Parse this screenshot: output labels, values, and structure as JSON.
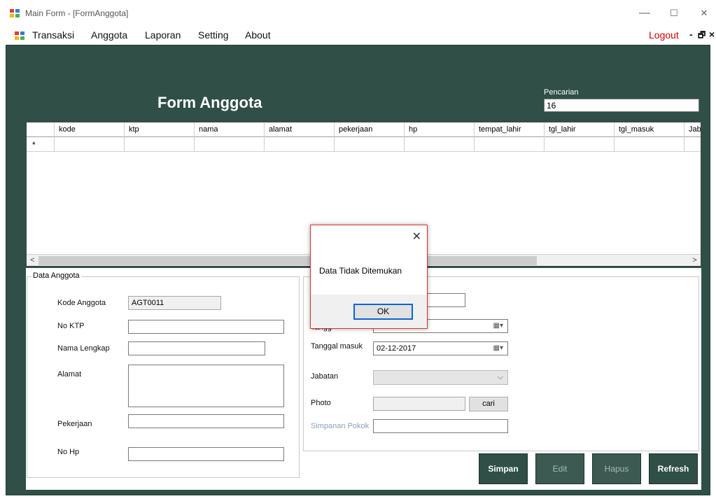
{
  "window": {
    "title": "Main Form - [FormAnggota]",
    "minimize": "—",
    "maximize": "☐",
    "close": "✕"
  },
  "menu": {
    "items": [
      "Transaksi",
      "Anggota",
      "Laporan",
      "Setting",
      "About"
    ],
    "logout": "Logout",
    "mdi_min": "-",
    "mdi_restore": "🗗",
    "mdi_close": "×"
  },
  "header": {
    "title": "Form Anggota",
    "search_label": "Pencarian",
    "search_value": "16"
  },
  "grid": {
    "columns": [
      "kode",
      "ktp",
      "nama",
      "alamat",
      "pekerjaan",
      "hp",
      "tempat_lahir",
      "tgl_lahir",
      "tgl_masuk",
      "Jab"
    ],
    "new_row_marker": "*",
    "scroll_left": "<",
    "scroll_right": ">"
  },
  "data_anggota": {
    "legend": "Data Anggota",
    "kode_label": "Kode Anggota",
    "kode_value": "AGT0011",
    "ktp_label": "No KTP",
    "nama_label": "Nama Lengkap",
    "alamat_label": "Alamat",
    "pekerjaan_label": "Pekerjaan",
    "hp_label": "No Hp"
  },
  "right_panel": {
    "tanggal_lahir_label": "Tangg",
    "tanggal_masuk_label": "Tanggal masuk",
    "tanggal_masuk_value": "02-12-2017",
    "jabatan_label": "Jabatan",
    "photo_label": "Photo",
    "cari_label": "cari",
    "simpanan_label": "Simpanan Pokok"
  },
  "actions": {
    "simpan": "Simpan",
    "edit": "Edit",
    "hapus": "Hapus",
    "refresh": "Refresh"
  },
  "dialog": {
    "message": "Data Tidak Ditemukan",
    "ok": "OK",
    "close": "✕"
  }
}
